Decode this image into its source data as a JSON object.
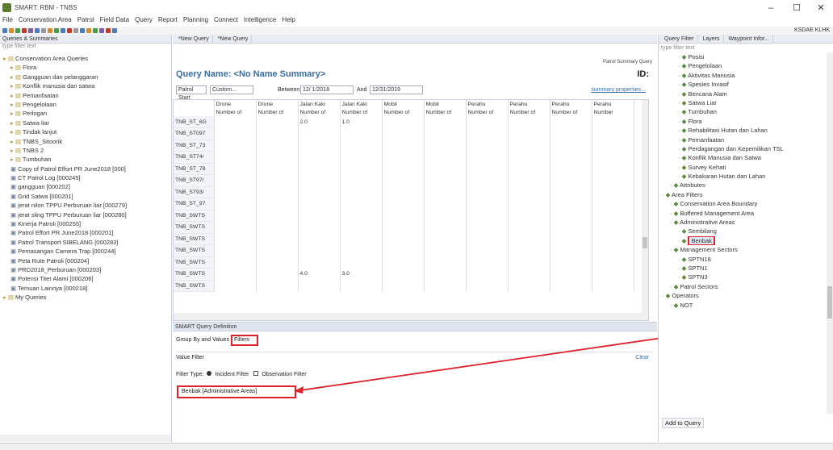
{
  "window": {
    "title": "SMART: RBM - TNBS",
    "min": "–",
    "max": "☐",
    "close": "✕"
  },
  "menu": [
    "File",
    "Conservation Area",
    "Patrol",
    "Field Data",
    "Query",
    "Report",
    "Planning",
    "Connect",
    "Intelligence",
    "Help"
  ],
  "toolbar_right_label": "KSDAE KLHK",
  "left": {
    "header": "Queries & Summaries",
    "filter_placeholder": "type filter text",
    "items": [
      {
        "text": "Conservation Area Queries",
        "kind": "folder",
        "indent": 0
      },
      {
        "text": "Flora",
        "kind": "folder",
        "indent": 1
      },
      {
        "text": "Gangguan dan pelanggaran",
        "kind": "folder",
        "indent": 1
      },
      {
        "text": "Konflik manusia dan satwa",
        "kind": "folder",
        "indent": 1
      },
      {
        "text": "Pemanfaatan",
        "kind": "folder",
        "indent": 1
      },
      {
        "text": "Pengelolaan",
        "kind": "folder",
        "indent": 1
      },
      {
        "text": "Perlogan",
        "kind": "folder",
        "indent": 1
      },
      {
        "text": "Satwa liar",
        "kind": "folder",
        "indent": 1
      },
      {
        "text": "Tindak lanjut",
        "kind": "folder",
        "indent": 1
      },
      {
        "text": "TNBS_Sitoorik",
        "kind": "folder",
        "indent": 1
      },
      {
        "text": "TNBS 2",
        "kind": "folder",
        "indent": 1
      },
      {
        "text": "Tumbuhan",
        "kind": "folder",
        "indent": 1
      },
      {
        "text": "Copy of Patrol Effort PR June2018 [000]",
        "kind": "query",
        "indent": 1
      },
      {
        "text": "CT Patrol Log [000245]",
        "kind": "query",
        "indent": 1
      },
      {
        "text": "gangguan [000202]",
        "kind": "query",
        "indent": 1
      },
      {
        "text": "Grid Satwa [000201]",
        "kind": "query",
        "indent": 1
      },
      {
        "text": "jerat nilon TPPU Perburuan liar [000279]",
        "kind": "query",
        "indent": 1
      },
      {
        "text": "jerat sling TPPU Perburuan liar [000280]",
        "kind": "query",
        "indent": 1
      },
      {
        "text": "Kinerja Patroli [000255]",
        "kind": "query",
        "indent": 1
      },
      {
        "text": "Patrol Effort PR June2018 [000201]",
        "kind": "query",
        "indent": 1
      },
      {
        "text": "Patrol Transport SIBELANG [000283]",
        "kind": "query",
        "indent": 1
      },
      {
        "text": "Pemasangan Camera Trap [000244]",
        "kind": "query",
        "indent": 1
      },
      {
        "text": "Peta Rute Patroli [000204]",
        "kind": "query",
        "indent": 1
      },
      {
        "text": "PRD2018_Perburuan [000203]",
        "kind": "query",
        "indent": 1
      },
      {
        "text": "Potensi Titer Alami [000206]",
        "kind": "query",
        "indent": 1
      },
      {
        "text": "Temuan Lainnya [000218]",
        "kind": "query",
        "indent": 1
      },
      {
        "text": "My Queries",
        "kind": "folder",
        "indent": 0
      }
    ]
  },
  "center": {
    "tabs": [
      "*New Query",
      "*New Query"
    ],
    "query_name": "Query Name: <No Name Summary>",
    "subtitle": "Patrol Summary Query",
    "id_label": "ID:",
    "row_select": "Patrol Start",
    "custom": "Custom...",
    "between_label": "Between",
    "start_date": "12/ 1/2018",
    "and_label": "And",
    "end_date": "12/31/2019",
    "summary_props": "summary properties...",
    "col_headers_top": [
      "Drone",
      "Drone",
      "Jalan Kaki",
      "Jalan Kaki",
      "Mobil",
      "Mobil",
      "Perahu",
      "Perahu",
      "Perahu",
      "Perahu"
    ],
    "col_headers_bottom": [
      "Number of",
      "Number of",
      "Number of",
      "Number of",
      "Number of",
      "Number of",
      "Number of",
      "Number of",
      "Number of",
      "Number"
    ],
    "rows": [
      {
        "head": "TNB_ST_6G",
        "cells": [
          "",
          "",
          "2.0",
          "1.0",
          "",
          "",
          "",
          "",
          "",
          ""
        ]
      },
      {
        "head": "TNB_ST097",
        "cells": [
          "",
          "",
          "",
          "",
          "",
          "",
          "",
          "",
          "",
          ""
        ]
      },
      {
        "head": "TNB_ST_73",
        "cells": [
          "",
          "",
          "",
          "",
          "",
          "",
          "",
          "",
          "",
          ""
        ]
      },
      {
        "head": "TNB_ST74/",
        "cells": [
          "",
          "",
          "",
          "",
          "",
          "",
          "",
          "",
          "",
          ""
        ]
      },
      {
        "head": "TNB_ST_78",
        "cells": [
          "",
          "",
          "",
          "",
          "",
          "",
          "",
          "",
          "",
          ""
        ]
      },
      {
        "head": "TNB_ST97/",
        "cells": [
          "",
          "",
          "",
          "",
          "",
          "",
          "",
          "",
          "",
          ""
        ]
      },
      {
        "head": "TNB_ST93/",
        "cells": [
          "",
          "",
          "",
          "",
          "",
          "",
          "",
          "",
          "",
          ""
        ]
      },
      {
        "head": "TNB_ST_97",
        "cells": [
          "",
          "",
          "",
          "",
          "",
          "",
          "",
          "",
          "",
          ""
        ]
      },
      {
        "head": "TNB_SWTS",
        "cells": [
          "",
          "",
          "",
          "",
          "",
          "",
          "",
          "",
          "",
          ""
        ]
      },
      {
        "head": "TNB_SWTS",
        "cells": [
          "",
          "",
          "",
          "",
          "",
          "",
          "",
          "",
          "",
          ""
        ]
      },
      {
        "head": "TNB_SWTS",
        "cells": [
          "",
          "",
          "",
          "",
          "",
          "",
          "",
          "",
          "",
          ""
        ]
      },
      {
        "head": "TNB_SWTS",
        "cells": [
          "",
          "",
          "",
          "",
          "",
          "",
          "",
          "",
          "",
          ""
        ]
      },
      {
        "head": "TNB_SWTS",
        "cells": [
          "",
          "",
          "",
          "",
          "",
          "",
          "",
          "",
          "",
          ""
        ]
      },
      {
        "head": "TNB_SWTS",
        "cells": [
          "",
          "",
          "4.0",
          "3.0",
          "",
          "",
          "",
          "",
          "",
          ""
        ]
      },
      {
        "head": "TNB_SWTS",
        "cells": [
          "",
          "",
          "",
          "",
          "",
          "",
          "",
          "",
          "",
          ""
        ]
      }
    ],
    "def_header": "SMART Query Definition",
    "group_label": "Group By and Values",
    "filters_tab": "Filters",
    "value_filter": "Value Filter",
    "clear_link": "Clear",
    "filter_type_label": "Filter Type:",
    "incident_filter": "Incident Filter",
    "observation_filter": "Observation Filter",
    "filter_chip": "Benbak [Administrative Areas]"
  },
  "right": {
    "tabs": [
      "Query Filter",
      "Layers",
      "Waypoint Infor..."
    ],
    "filter_placeholder": "type filter text",
    "items": [
      {
        "text": "Posisi",
        "indent": 2
      },
      {
        "text": "Pengelolaan",
        "indent": 2
      },
      {
        "text": "Aktivitas Manusia",
        "indent": 2
      },
      {
        "text": "Spesies Invasif",
        "indent": 2
      },
      {
        "text": "Bencana Alam",
        "indent": 2
      },
      {
        "text": "Satwa Liar",
        "indent": 2
      },
      {
        "text": "Tumbuhan",
        "indent": 2
      },
      {
        "text": "Flora",
        "indent": 2
      },
      {
        "text": "Rehabilitasi Hutan dan Lahan",
        "indent": 2
      },
      {
        "text": "Pemanfaatan",
        "indent": 2
      },
      {
        "text": "Perdagangan dan Kepemilikan TSL",
        "indent": 2
      },
      {
        "text": "Konflik Manusia dan Satwa",
        "indent": 2
      },
      {
        "text": "Survey Kehati",
        "indent": 2
      },
      {
        "text": "Kebakaran Hutan dan Lahan",
        "indent": 2
      },
      {
        "text": "Attributes",
        "indent": 1
      },
      {
        "text": "Area Filters",
        "indent": 0
      },
      {
        "text": "Conservation Area Boundary",
        "indent": 1
      },
      {
        "text": "Buffered Management Area",
        "indent": 1
      },
      {
        "text": "Administrative Areas",
        "indent": 1
      },
      {
        "text": "Sembilang",
        "indent": 2
      },
      {
        "text": "Benbak",
        "indent": 2,
        "selected": true
      },
      {
        "text": "Management Sectors",
        "indent": 1
      },
      {
        "text": "SPTN18",
        "indent": 2
      },
      {
        "text": "SPTN1",
        "indent": 2
      },
      {
        "text": "SPTN3",
        "indent": 2
      },
      {
        "text": "Patrol Sectors",
        "indent": 1
      },
      {
        "text": "Operators",
        "indent": 0
      },
      {
        "text": "NOT",
        "indent": 1
      }
    ],
    "add_button": "Add to Query"
  },
  "colors": {
    "accent": "#3a6ea5",
    "highlight": "#e0202a",
    "panel": "#e8ecf3"
  }
}
